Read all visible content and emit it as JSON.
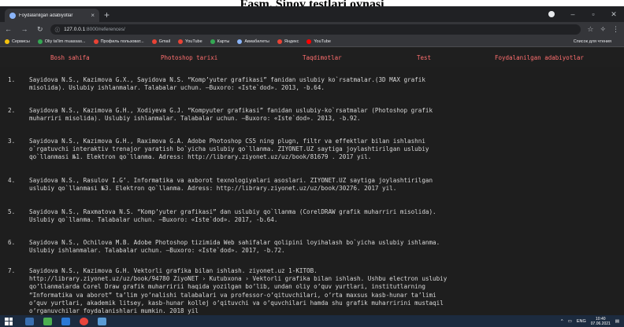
{
  "caption": "Fasm. Sinov testlari oynasi",
  "browser": {
    "tab_title": "Foydalanilgan adabiyotlar",
    "tab_close": "×",
    "new_tab": "+",
    "url_host": "127.0.0.1",
    "url_path": ":8000/references/",
    "bookmarks": [
      "Сервисы",
      "Oliy ta'lim muassas...",
      "Профиль пользоват...",
      "Gmail",
      "YouTube",
      "Карты",
      "Авиабилеты",
      "Яндекс",
      "YouTube"
    ],
    "bookmarks_right": "Список для чтения",
    "icon_colors": {
      "bookmark_dot": "#8ab4f8"
    }
  },
  "site_nav": [
    "Bosh sahifa",
    "Photoshop tarixi",
    "Taqdimotlar",
    "Test",
    "Foydalanilgan adabiyotlar"
  ],
  "references": [
    {
      "num": "1.",
      "text": "Sayidova N.S., Kazimova G.X., Sayidova N.S. “Komp’yuter grafikasi” fanidan uslubiy ko`rsatmalar.(3D MAX grafik\nmisolida). Uslubiy ishlanmalar. Talabalar uchun. –Buxoro: «Iste`dod». 2013, -b.64."
    },
    {
      "num": "2.",
      "text": "Sayidova N.S., Kazimova G.H., Xodiyeva G.J. “Kompyuter grafikasi” fanidan uslubiy-ko`rsatmalar (Photoshop grafik\nmuharriri misolida). Uslubiy ishlanmalar. Talabalar uchun. –Buxoro: «Iste`dod». 2013, -b.92."
    },
    {
      "num": "3.",
      "text": "Sayidova N.S., Kazimova G.H., Raximova G.A. Adobe Photoshop CS5 ning plugn, filtr va effektlar bilan ishlashni\no`rgatuvchi interaktiv trenajor yaratish bo`yicha uslubiy qo`llanma. ZIYONET.UZ saytiga joylashtirilgan uslubiy\nqo`llanmasi №1. Elektron qo`llanma. Adress: http://library.ziyonet.uz/uz/book/81679 . 2017 yil."
    },
    {
      "num": "4.",
      "text": "Sayidova N.S., Rasulov I.G’. Informatika va axborot texnologiyalari asoslari. ZIYONET.UZ saytiga joylashtirilgan\nuslubiy qo`llanmasi №3. Elektron qo`llanma. Adress: http://library.ziyonet.uz/uz/book/30276. 2017 yil."
    },
    {
      "num": "5.",
      "text": "Sayidova N.S., Raxmatova N.S. “Komp’yuter grafikasi” dan uslubiy qo`llanma (CorelDRAW grafik muharriri misolida).\nUslubiy qo`llanma. Talabalar uchun. –Buxoro: «Iste`dod». 2017, -b.64."
    },
    {
      "num": "6.",
      "text": "Sayidova N.S., Ochilova M.B. Adobe Photoshop tizimida Web sahifalar qolipini loyihalash bo`yicha uslubiy ishlanma.\nUslubiy ishlanmalar. Talabalar uchun. –Buxoro: «Iste`dod». 2017, -b.72."
    },
    {
      "num": "7.",
      "text": "Sayidova N.S., Kazimova G.H. Vektorli grafika bilan ishlash. ziyonet.uz 1-KITOB.\nhttp://library.ziyonet.uz/uz/book/94780 ZiyoNET › Kutubxona › Vektorli grafika bilan ishlash. Ushbu electron uslubiy\nqo’llanmalarda Corel Draw grafik muharririi haqida yozilgan bo’lib, undan oliy o’quv yurtlari, institutlarning\n“Informatika va aborot” ta’lim yo’nalishi talabalari va professor-o’qituvchilari, o’rta maxsus kasb-hunar ta’limi\no’quv yurtlari, akademik litsey, kasb-hunar kollej o’qituvchi va o’quvchilari hamda shu grafik muharririni mustaqil\no’rganuvchilar foydalanishlari mumkin. 2018 yil"
    }
  ],
  "taskbar": {
    "lang": "ENG",
    "time": "10:40",
    "date": "07.06.2021"
  }
}
